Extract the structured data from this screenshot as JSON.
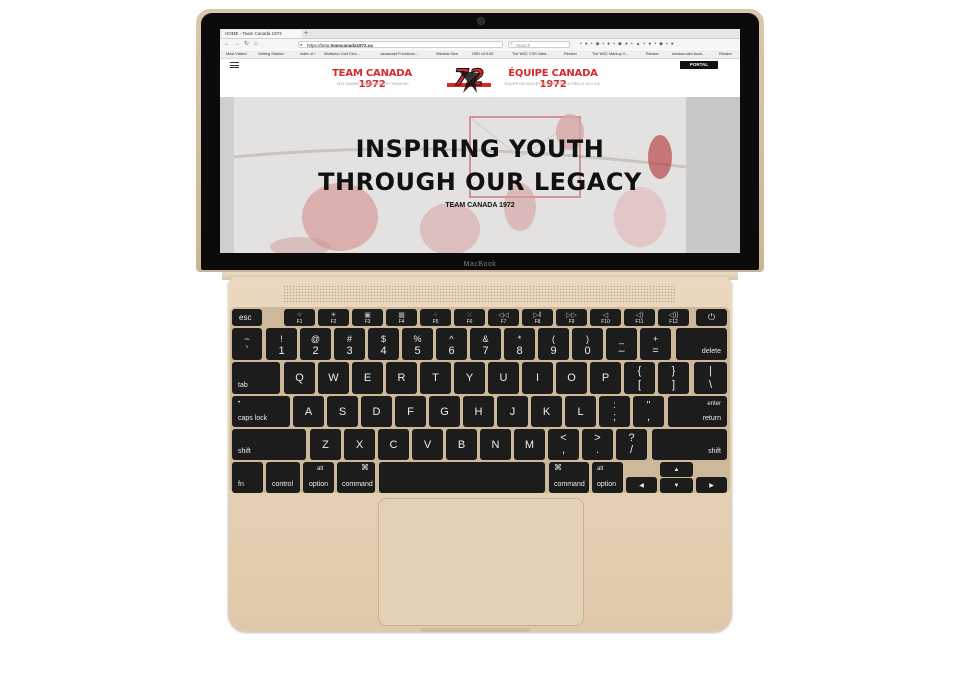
{
  "device": {
    "brand": "MacBook"
  },
  "browser": {
    "tab_title": "HOME - Team Canada 1972",
    "new_tab": "+",
    "url_prefix": "https://beta.",
    "url_domain": "teamcanada1972.ca",
    "search_placeholder": "Search",
    "bookmarks": [
      "Most Visited",
      "Getting Started",
      "index of /",
      "Wolfsdon Golf Club...",
      "Javascript Functions...",
      "Window Size",
      "HSD v3.5.62",
      "The W3C CSS Valid...",
      "Resizer",
      "The W3C Markup V...",
      "Resizer",
      "window-size-book...",
      "Resizer"
    ]
  },
  "site": {
    "title_en": "TEAM CANADA 1972",
    "subtitle_en": "1972 SUMMIT SERIES HOCKEY TEAM INC.",
    "title_fr": "ÉQUIPE CANADA 1972",
    "subtitle_fr": "ÉQUIPE DE HOCKEY DE LA SÉRIE DU SIÈCLE 1972 INC.",
    "logo_text": "72",
    "portal_label": "PORTAL",
    "hero_line1": "INSPIRING YOUTH",
    "hero_line2": "THROUGH OUR LEGACY",
    "hero_sub": "TEAM CANADA 1972"
  },
  "keyboard": {
    "esc": "esc",
    "function_keys": [
      "F1",
      "F2",
      "F3",
      "F4",
      "F5",
      "F6",
      "F7",
      "F8",
      "F9",
      "F10",
      "F11",
      "F12"
    ],
    "number_row": [
      {
        "top": "~",
        "bot": "`"
      },
      {
        "top": "!",
        "bot": "1"
      },
      {
        "top": "@",
        "bot": "2"
      },
      {
        "top": "#",
        "bot": "3"
      },
      {
        "top": "$",
        "bot": "4"
      },
      {
        "top": "%",
        "bot": "5"
      },
      {
        "top": "^",
        "bot": "6"
      },
      {
        "top": "&",
        "bot": "7"
      },
      {
        "top": "*",
        "bot": "8"
      },
      {
        "top": "(",
        "bot": "9"
      },
      {
        "top": ")",
        "bot": "0"
      },
      {
        "top": "_",
        "bot": "–"
      },
      {
        "top": "+",
        "bot": "="
      }
    ],
    "delete": "delete",
    "tab": "tab",
    "qwerty_row": [
      "Q",
      "W",
      "E",
      "R",
      "T",
      "Y",
      "U",
      "I",
      "O",
      "P"
    ],
    "bracket_left": {
      "top": "{",
      "bot": "["
    },
    "bracket_right": {
      "top": "}",
      "bot": "]"
    },
    "backslash": {
      "top": "|",
      "bot": "\\"
    },
    "caps_lock": "caps lock",
    "caps_dot": "•",
    "home_row": [
      "A",
      "S",
      "D",
      "F",
      "G",
      "H",
      "J",
      "K",
      "L"
    ],
    "semicolon": {
      "top": ":",
      "bot": ";"
    },
    "quote": {
      "top": "\"",
      "bot": ","
    },
    "enter_top": "enter",
    "enter_bot": "return",
    "shift": "shift",
    "bottom_letters": [
      "Z",
      "X",
      "C",
      "V",
      "B",
      "N",
      "M"
    ],
    "comma": {
      "top": "<",
      "bot": ","
    },
    "period": {
      "top": ">",
      "bot": "."
    },
    "slash": {
      "top": "?",
      "bot": "/"
    },
    "fn": "fn",
    "control": "control",
    "option": "option",
    "alt": "alt",
    "command": "command",
    "command_symbol": "⌘",
    "arrow_left": "◀",
    "arrow_up": "▲",
    "arrow_down": "▼",
    "arrow_right": "▶"
  }
}
